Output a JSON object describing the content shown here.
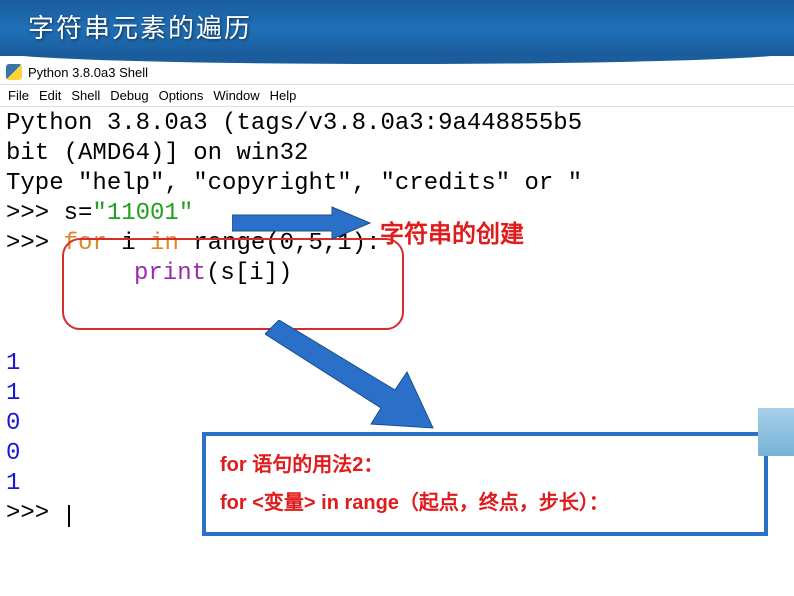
{
  "slide": {
    "title": "字符串元素的遍历"
  },
  "shell": {
    "window_title": "Python 3.8.0a3 Shell",
    "menu": [
      "File",
      "Edit",
      "Shell",
      "Debug",
      "Options",
      "Window",
      "Help"
    ]
  },
  "code": {
    "banner1": "Python 3.8.0a3 (tags/v3.8.0a3:9a448855b5",
    "banner2": "bit (AMD64)] on win32",
    "banner3_a": "Type ",
    "banner3_b": "\"help\"",
    "banner3_c": ", ",
    "banner3_d": "\"copyright\"",
    "banner3_e": ", ",
    "banner3_f": "\"credits\"",
    "banner3_g": " or ",
    "banner3_h": "\"",
    "prompt": ">>> ",
    "line1_a": "s=",
    "line1_b": "\"11001\"",
    "line2_a": "for",
    "line2_b": " i ",
    "line2_c": "in",
    "line2_d": " range(0,5,1):",
    "line3_a": "print",
    "line3_b": "(s[i])",
    "output": [
      "1",
      "1",
      "0",
      "0",
      "1"
    ]
  },
  "annotations": {
    "create_string": "字符串的创建",
    "for_usage_title": "for 语句的用法2：",
    "for_usage_syntax": "for <变量> in range（起点，终点，步长）："
  }
}
